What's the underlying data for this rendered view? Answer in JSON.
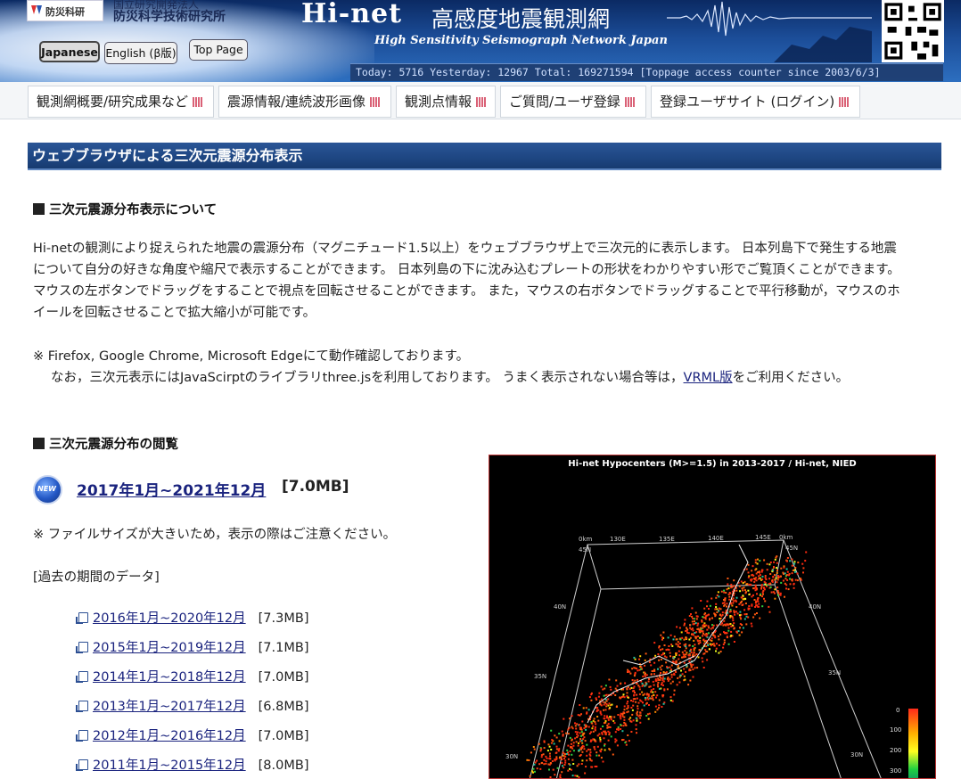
{
  "header": {
    "logo_text": "防災科研",
    "org_line1": "国立研究開発法人",
    "org_line2": "防災科学技術研究所",
    "title_en": "Hi-net",
    "title_jp": "高感度地震観測網",
    "subtitle": "High Sensitivity Seismograph Network Japan",
    "counter": "Today: 5716   Yesterday: 12967   Total: 169271594  [Toppage access counter since 2003/6/3]"
  },
  "lang": {
    "japanese": "Japanese",
    "english": "English (β版)",
    "top_page": "Top Page"
  },
  "nav": {
    "items": [
      {
        "label": "観測網概要/研究成果など"
      },
      {
        "label": "震源情報/連続波形画像"
      },
      {
        "label": "観測点情報"
      },
      {
        "label": "ご質問/ユーザ登録"
      },
      {
        "label": "登録ユーザサイト (ログイン)"
      }
    ]
  },
  "main": {
    "section_title": "ウェブブラウザによる三次元震源分布表示",
    "about_heading": "三次元震源分布表示について",
    "about_lines": [
      "Hi-netの観測により捉えられた地震の震源分布（マグニチュード1.5以上）をウェブブラウザ上で三次元的に表示します。 日本列島下で発生する地震",
      "について自分の好きな角度や縮尺で表示することができます。 日本列島の下に沈み込むプレートの形状をわかりやすい形でご覧頂くことができます。",
      "マウスの左ボタンでドラッグをすることで視点を回転させることができます。 また，マウスの右ボタンでドラッグすることで平行移動が，マウスのホ",
      "イールを回転させることで拡大縮小が可能です。"
    ],
    "note_line1": "※ Firefox, Google Chrome, Microsoft Edgeにて動作確認しております。",
    "note_line2_pre": "なお，三次元表示にはJavaScirptのライブラリthree.jsを利用しております。 うまく表示されない場合等は，",
    "note_line2_link": "VRML版",
    "note_line2_post": "をご利用ください。",
    "browse_heading": "三次元震源分布の閲覧",
    "new_badge": "NEW",
    "latest_link": "2017年1月~2021年12月",
    "latest_size": "[7.0MB]",
    "size_warning": "※ ファイルサイズが大きいため，表示の際はご注意ください。",
    "past_label": "[過去の期間のデータ]",
    "past_items": [
      {
        "label": "2016年1月~2020年12月",
        "size": "[7.3MB]"
      },
      {
        "label": "2015年1月~2019年12月",
        "size": "[7.1MB]"
      },
      {
        "label": "2014年1月~2018年12月",
        "size": "[7.0MB]"
      },
      {
        "label": "2013年1月~2017年12月",
        "size": "[6.8MB]"
      },
      {
        "label": "2012年1月~2016年12月",
        "size": "[7.0MB]"
      },
      {
        "label": "2011年1月~2015年12月",
        "size": "[8.0MB]"
      }
    ]
  },
  "preview": {
    "title": "Hi-net Hypocenters (M>=1.5) in 2013-2017 / Hi-net, NIED",
    "lat_labels": [
      "45N",
      "40N",
      "35N",
      "30N",
      "45N",
      "40N",
      "35N",
      "30N"
    ],
    "lon_labels": [
      "130E",
      "135E",
      "140E",
      "145E"
    ],
    "depth_labels": [
      "0km",
      "0km"
    ],
    "scale_labels": [
      "0",
      "100",
      "200",
      "300"
    ]
  }
}
